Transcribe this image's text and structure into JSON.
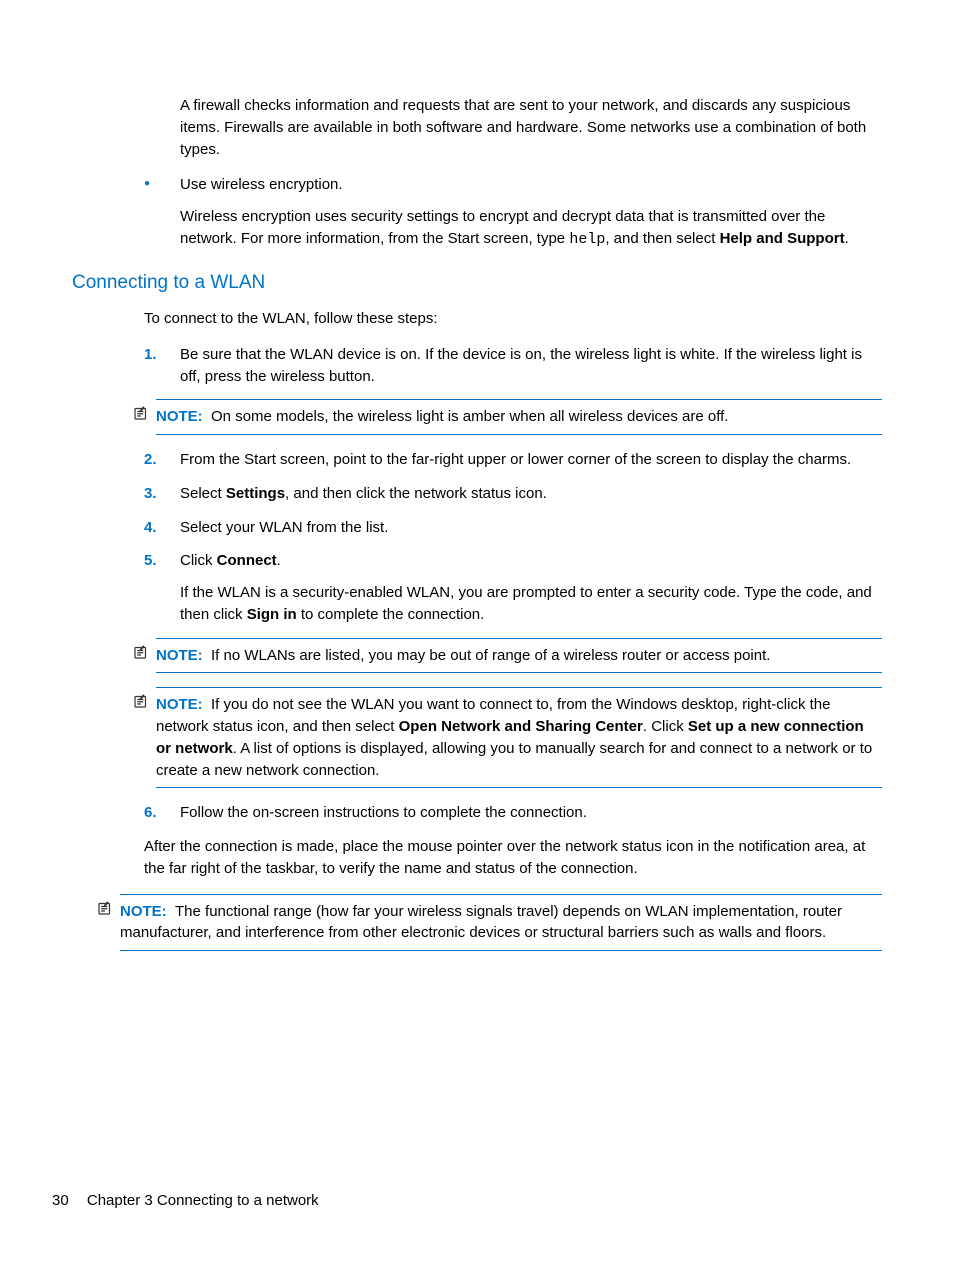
{
  "intro_para": "A firewall checks information and requests that are sent to your network, and discards any suspicious items. Firewalls are available in both software and hardware. Some networks use a combination of both types.",
  "bullet1_lead": "Use wireless encryption.",
  "bullet1_body_a": "Wireless encryption uses security settings to encrypt and decrypt data that is transmitted over the network. For more information, from the Start screen, type ",
  "bullet1_body_mono": "help",
  "bullet1_body_b": ", and then select ",
  "bullet1_body_bold": "Help and Support",
  "bullet1_body_c": ".",
  "heading": "Connecting to a WLAN",
  "steps_intro": "To connect to the WLAN, follow these steps:",
  "step1_num": "1.",
  "step1": "Be sure that the WLAN device is on. If the device is on, the wireless light is white. If the wireless light is off, press the wireless button.",
  "note1_label": "NOTE:",
  "note1_text": "On some models, the wireless light is amber when all wireless devices are off.",
  "step2_num": "2.",
  "step2": "From the Start screen, point to the far-right upper or lower corner of the screen to display the charms.",
  "step3_num": "3.",
  "step3_a": "Select ",
  "step3_bold": "Settings",
  "step3_b": ", and then click the network status icon.",
  "step4_num": "4.",
  "step4": "Select your WLAN from the list.",
  "step5_num": "5.",
  "step5_a": "Click ",
  "step5_bold": "Connect",
  "step5_b": ".",
  "step5_body_a": "If the WLAN is a security-enabled WLAN, you are prompted to enter a security code. Type the code, and then click ",
  "step5_body_bold": "Sign in",
  "step5_body_b": " to complete the connection.",
  "note2_label": "NOTE:",
  "note2_text": "If no WLANs are listed, you may be out of range of a wireless router or access point.",
  "note3_label": "NOTE:",
  "note3_a": "If you do not see the WLAN you want to connect to, from the Windows desktop, right-click the network status icon, and then select ",
  "note3_bold1": "Open Network and Sharing Center",
  "note3_b": ". Click ",
  "note3_bold2": "Set up a new connection or network",
  "note3_c": ". A list of options is displayed, allowing you to manually search for and connect to a network or to create a new network connection.",
  "step6_num": "6.",
  "step6": "Follow the on-screen instructions to complete the connection.",
  "after": "After the connection is made, place the mouse pointer over the network status icon in the notification area, at the far right of the taskbar, to verify the name and status of the connection.",
  "note4_label": "NOTE:",
  "note4_text": "The functional range (how far your wireless signals travel) depends on WLAN implementation, router manufacturer, and interference from other electronic devices or structural barriers such as walls and floors.",
  "footer_page": "30",
  "footer_chapter": "Chapter 3   Connecting to a network"
}
